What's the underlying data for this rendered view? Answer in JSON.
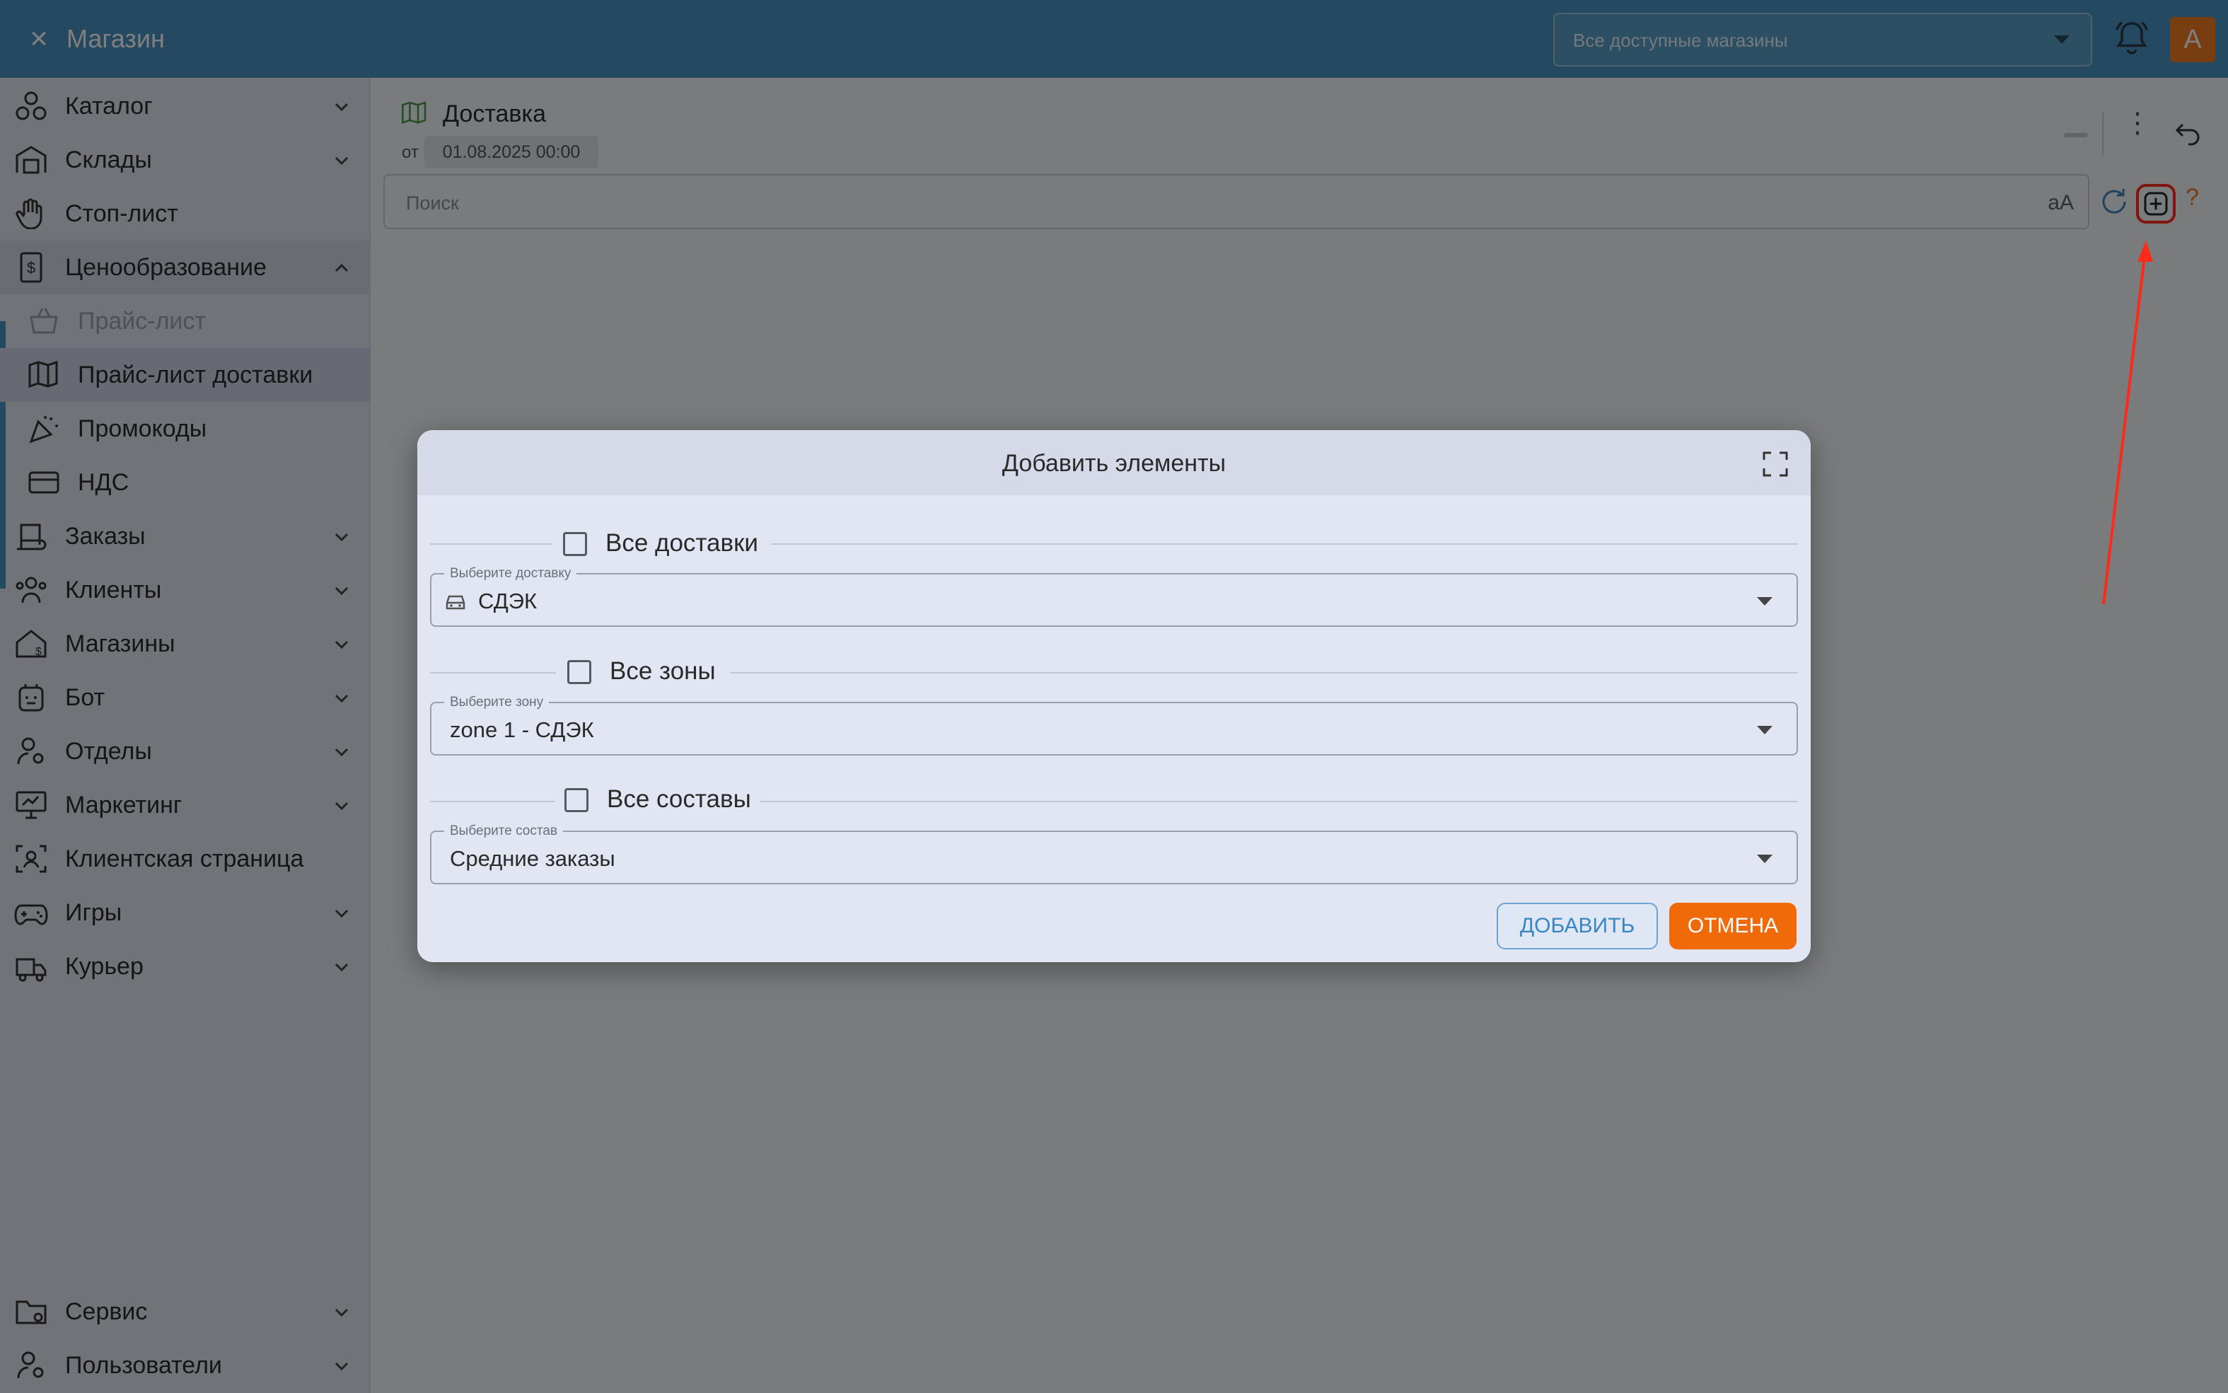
{
  "topbar": {
    "close_glyph": "×",
    "title": "Магазин",
    "store_select": "Все доступные магазины",
    "avatar_letter": "А"
  },
  "sidebar": {
    "items": [
      {
        "label": "Каталог",
        "icon": "catalog-icon"
      },
      {
        "label": "Склады",
        "icon": "warehouse-icon"
      },
      {
        "label": "Стоп-лист",
        "icon": "hand-icon"
      },
      {
        "label": "Ценообразование",
        "icon": "price-doc-icon"
      },
      {
        "label": "Прайс-лист",
        "icon": "basket-icon"
      },
      {
        "label": "Прайс-лист доставки",
        "icon": "map-price-icon"
      },
      {
        "label": "Промокоды",
        "icon": "party-icon"
      },
      {
        "label": "НДС",
        "icon": "card-icon"
      },
      {
        "label": "Заказы",
        "icon": "orders-icon"
      },
      {
        "label": "Клиенты",
        "icon": "clients-icon"
      },
      {
        "label": "Магазины",
        "icon": "stores-icon"
      },
      {
        "label": "Бот",
        "icon": "bot-icon"
      },
      {
        "label": "Отделы",
        "icon": "departments-icon"
      },
      {
        "label": "Маркетинг",
        "icon": "marketing-icon"
      },
      {
        "label": "Клиентская страница",
        "icon": "client-page-icon"
      },
      {
        "label": "Игры",
        "icon": "gamepad-icon"
      },
      {
        "label": "Курьер",
        "icon": "courier-icon"
      },
      {
        "label": "Сервис",
        "icon": "service-icon"
      },
      {
        "label": "Пользователи",
        "icon": "users-icon"
      }
    ]
  },
  "document": {
    "title": "Доставка",
    "from_label": "от",
    "date": "01.08.2025 00:00",
    "kebab": "⋮",
    "search_placeholder": "Поиск",
    "case_toggle": "aA",
    "help": "?"
  },
  "dialog": {
    "title": "Добавить элементы",
    "sections": [
      {
        "check_label": "Все доставки",
        "field_label": "Выберите доставку",
        "value": "СДЭК"
      },
      {
        "check_label": "Все зоны",
        "field_label": "Выберите зону",
        "value": "zone 1 - СДЭК"
      },
      {
        "check_label": "Все составы",
        "field_label": "Выберите состав",
        "value": "Средние заказы"
      }
    ],
    "add_label": "ДОБАВИТЬ",
    "cancel_label": "ОТМЕНА"
  },
  "colors": {
    "topbar": "#4a93c0",
    "accent_orange": "#f06a0a",
    "highlight_red": "#ff2a1a",
    "link_blue": "#3a86c2"
  }
}
